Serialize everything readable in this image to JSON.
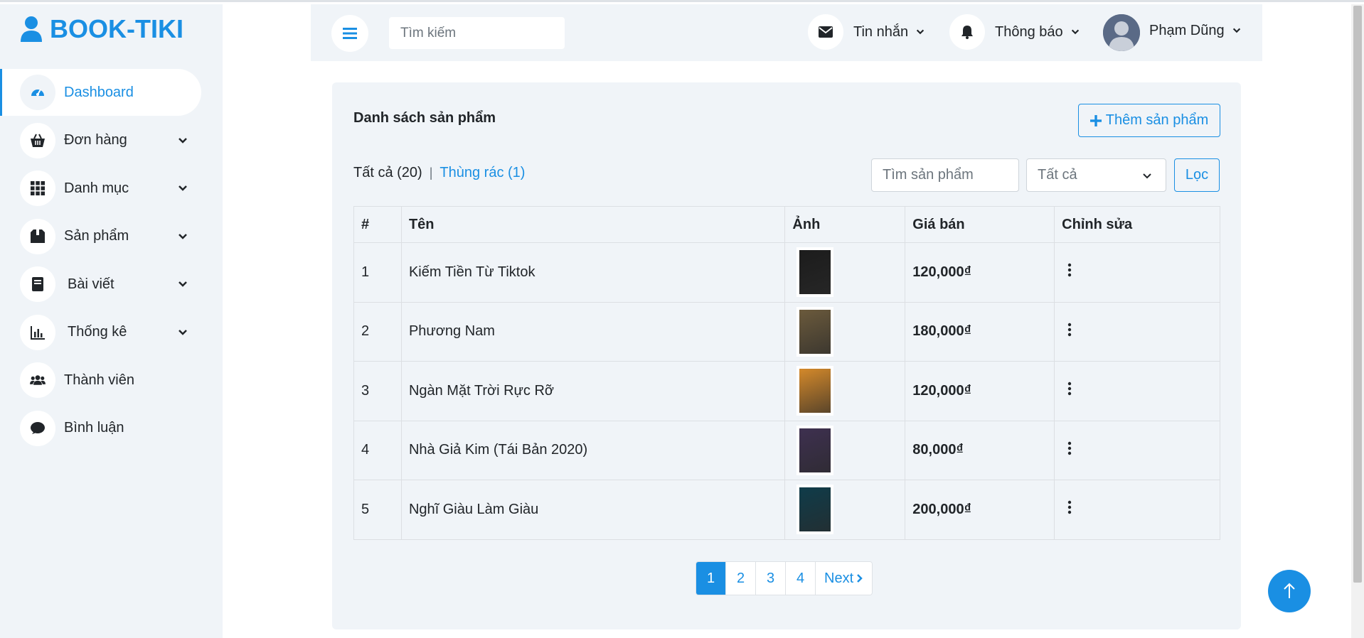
{
  "brand": {
    "name": "BOOK-TIKI",
    "icon": "user-icon"
  },
  "sidebar": {
    "items": [
      {
        "label": "Dashboard",
        "icon": "gauge-icon",
        "active": true,
        "expandable": false
      },
      {
        "label": "Đơn hàng",
        "icon": "basket-icon",
        "active": false,
        "expandable": true
      },
      {
        "label": "Danh mục",
        "icon": "grid-icon",
        "active": false,
        "expandable": true
      },
      {
        "label": "Sản phẩm",
        "icon": "box-icon",
        "active": false,
        "expandable": true
      },
      {
        "label": "Bài viết",
        "icon": "book-icon",
        "active": false,
        "expandable": true
      },
      {
        "label": "Thống kê",
        "icon": "bar-chart-icon",
        "active": false,
        "expandable": true
      },
      {
        "label": "Thành viên",
        "icon": "users-icon",
        "active": false,
        "expandable": false
      },
      {
        "label": "Bình luận",
        "icon": "comment-icon",
        "active": false,
        "expandable": false
      }
    ]
  },
  "topbar": {
    "search_placeholder": "Tìm kiếm",
    "messages_label": "Tin nhắn",
    "notifications_label": "Thông báo",
    "user_name": "Phạm Dũng"
  },
  "main": {
    "title": "Danh sách sản phẩm",
    "add_button": "Thêm sản phẩm",
    "filter_all": "Tất cả (20)",
    "filter_separator": "|",
    "filter_trash": "Thùng rác (1)",
    "product_search_placeholder": "Tìm sản phẩm",
    "select_value": "Tất cả",
    "filter_button": "Lọc",
    "table": {
      "headers": [
        "#",
        "Tên",
        "Ảnh",
        "Giá bán",
        "Chỉnh sửa"
      ],
      "rows": [
        {
          "index": "1",
          "name": "Kiếm Tiền Từ Tiktok",
          "price": "120,000₫",
          "cover": "#1c1c1c"
        },
        {
          "index": "2",
          "name": "Phương Nam",
          "price": "180,000₫",
          "cover": "#6b5a3c"
        },
        {
          "index": "3",
          "name": "Ngàn Mặt Trời Rực Rỡ",
          "price": "120,000₫",
          "cover": "#d4892a"
        },
        {
          "index": "4",
          "name": "Nhà Giả Kim (Tái Bản 2020)",
          "price": "80,000₫",
          "cover": "#3e3050"
        },
        {
          "index": "5",
          "name": "Nghĩ Giàu Làm Giàu",
          "price": "200,000₫",
          "cover": "#0f3c4a"
        }
      ]
    },
    "pagination": {
      "pages": [
        "1",
        "2",
        "3",
        "4"
      ],
      "active_page": "1",
      "next_label": "Next"
    }
  },
  "colors": {
    "accent": "#1a8fe3",
    "panel": "#f0f4f8"
  }
}
